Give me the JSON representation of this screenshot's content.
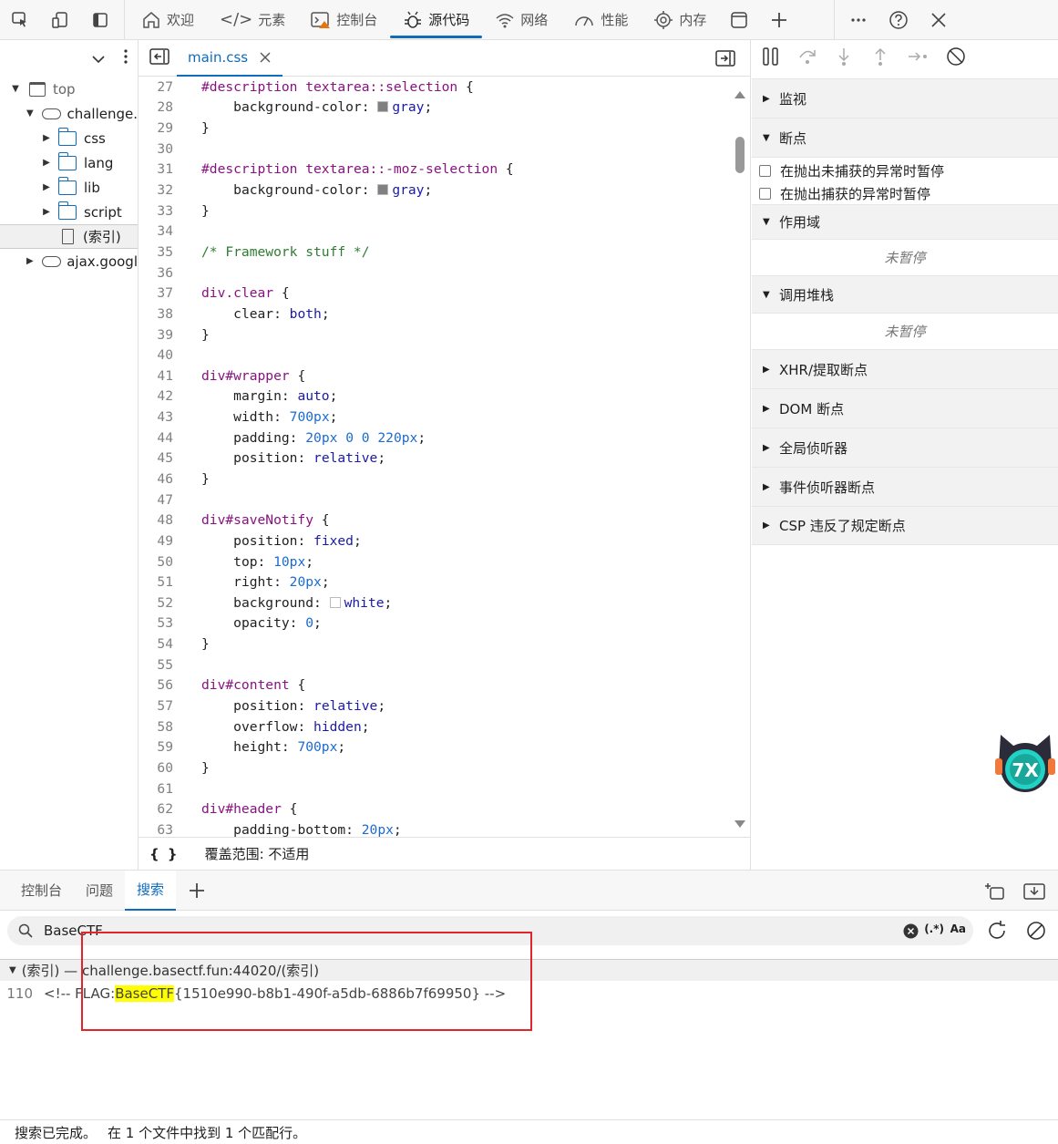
{
  "toolbar": {
    "tabs": [
      {
        "label": "欢迎",
        "icon": "home-icon"
      },
      {
        "label": "元素",
        "icon": "code-icon"
      },
      {
        "label": "控制台",
        "icon": "console-icon"
      },
      {
        "label": "源代码",
        "icon": "bug-icon",
        "active": true
      },
      {
        "label": "网络",
        "icon": "wifi-icon"
      },
      {
        "label": "性能",
        "icon": "gauge-icon"
      },
      {
        "label": "内存",
        "icon": "chip-icon"
      }
    ]
  },
  "navigator": {
    "items": [
      {
        "label": "top",
        "kind": "window"
      },
      {
        "label": "challenge.",
        "kind": "cloud"
      },
      {
        "label": "css",
        "kind": "folder"
      },
      {
        "label": "lang",
        "kind": "folder"
      },
      {
        "label": "lib",
        "kind": "folder"
      },
      {
        "label": "script",
        "kind": "folder"
      },
      {
        "label": "(索引)",
        "kind": "file"
      },
      {
        "label": "ajax.googl",
        "kind": "cloud"
      }
    ]
  },
  "editor": {
    "tab_label": "main.css",
    "coverage": "覆盖范围: 不适用",
    "braces": "{ }",
    "lines": [
      {
        "n": "27",
        "t": "#description textarea::selection {"
      },
      {
        "n": "28",
        "t": "    background-color: gray;"
      },
      {
        "n": "29",
        "t": "}"
      },
      {
        "n": "30",
        "t": ""
      },
      {
        "n": "31",
        "t": "#description textarea::-moz-selection {"
      },
      {
        "n": "32",
        "t": "    background-color: gray;"
      },
      {
        "n": "33",
        "t": "}"
      },
      {
        "n": "34",
        "t": ""
      },
      {
        "n": "35",
        "t": "/* Framework stuff */"
      },
      {
        "n": "36",
        "t": ""
      },
      {
        "n": "37",
        "t": "div.clear {"
      },
      {
        "n": "38",
        "t": "    clear: both;"
      },
      {
        "n": "39",
        "t": "}"
      },
      {
        "n": "40",
        "t": ""
      },
      {
        "n": "41",
        "t": "div#wrapper {"
      },
      {
        "n": "42",
        "t": "    margin: auto;"
      },
      {
        "n": "43",
        "t": "    width: 700px;"
      },
      {
        "n": "44",
        "t": "    padding: 20px 0 0 220px;"
      },
      {
        "n": "45",
        "t": "    position: relative;"
      },
      {
        "n": "46",
        "t": "}"
      },
      {
        "n": "47",
        "t": ""
      },
      {
        "n": "48",
        "t": "div#saveNotify {"
      },
      {
        "n": "49",
        "t": "    position: fixed;"
      },
      {
        "n": "50",
        "t": "    top: 10px;"
      },
      {
        "n": "51",
        "t": "    right: 20px;"
      },
      {
        "n": "52",
        "t": "    background: white;"
      },
      {
        "n": "53",
        "t": "    opacity: 0;"
      },
      {
        "n": "54",
        "t": "}"
      },
      {
        "n": "55",
        "t": ""
      },
      {
        "n": "56",
        "t": "div#content {"
      },
      {
        "n": "57",
        "t": "    position: relative;"
      },
      {
        "n": "58",
        "t": "    overflow: hidden;"
      },
      {
        "n": "59",
        "t": "    height: 700px;"
      },
      {
        "n": "60",
        "t": "}"
      },
      {
        "n": "61",
        "t": ""
      },
      {
        "n": "62",
        "t": "div#header {"
      },
      {
        "n": "63",
        "t": "    padding-bottom: 20px;"
      }
    ]
  },
  "debugger": {
    "sections": [
      {
        "label": "监视",
        "open": false
      },
      {
        "label": "断点",
        "open": true
      },
      {
        "label": "作用域",
        "open": true
      },
      {
        "label": "调用堆栈",
        "open": true
      },
      {
        "label": "XHR/提取断点",
        "open": false
      },
      {
        "label": "DOM 断点",
        "open": false
      },
      {
        "label": "全局侦听器",
        "open": false
      },
      {
        "label": "事件侦听器断点",
        "open": false
      },
      {
        "label": "CSP 违反了规定断点",
        "open": false
      }
    ],
    "pause_uncaught": "在抛出未捕获的异常时暂停",
    "pause_caught": "在抛出捕获的异常时暂停",
    "not_paused": "未暂停"
  },
  "drawer": {
    "tabs": [
      "控制台",
      "问题",
      "搜索"
    ],
    "search_value": "BaseCTF",
    "regex_label": "(.*)",
    "case_label": "Aa",
    "result_file": "(索引) — challenge.basectf.fun:44020/(索引)",
    "result_line_no": "110",
    "result_pre": "<!-- FLAG: ",
    "result_match": "BaseCTF",
    "result_post": "{1510e990-b8b1-490f-a5db-6886b7f69950} -->",
    "status_done": "搜索已完成。",
    "status_found": "在 1 个文件中找到 1 个匹配行。"
  }
}
